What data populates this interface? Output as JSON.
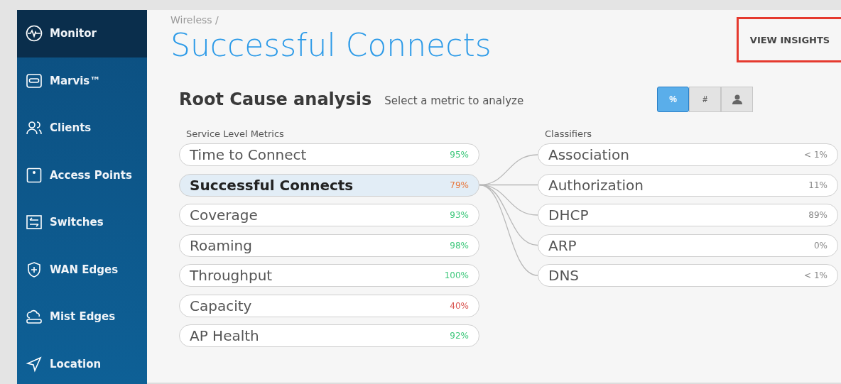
{
  "sidebar": {
    "items": [
      {
        "label": "Monitor",
        "kind": "monitor",
        "selected": true
      },
      {
        "label": "Marvis™",
        "kind": "marvis",
        "selected": false
      },
      {
        "label": "Clients",
        "kind": "clients",
        "selected": false
      },
      {
        "label": "Access Points",
        "kind": "ap",
        "selected": false
      },
      {
        "label": "Switches",
        "kind": "switches",
        "selected": false
      },
      {
        "label": "WAN Edges",
        "kind": "wan",
        "selected": false
      },
      {
        "label": "Mist Edges",
        "kind": "mist",
        "selected": false
      },
      {
        "label": "Location",
        "kind": "location",
        "selected": false
      }
    ]
  },
  "breadcrumb": "Wireless /",
  "title": "Successful Connects",
  "view_insights": "VIEW INSIGHTS",
  "analysis": {
    "heading": "Root Cause analysis",
    "hint": "Select a metric to analyze",
    "units": [
      {
        "kind": "text",
        "label": "%",
        "selected": true
      },
      {
        "kind": "text",
        "label": "#",
        "selected": false
      },
      {
        "kind": "person",
        "selected": false
      }
    ],
    "metrics_heading": "Service Level Metrics",
    "metrics": [
      {
        "name": "Time to Connect",
        "value": "95%",
        "color": "#3cc77a",
        "selected": false
      },
      {
        "name": "Successful Connects",
        "value": "79%",
        "color": "#e8773c",
        "selected": true
      },
      {
        "name": "Coverage",
        "value": "93%",
        "color": "#3cc77a",
        "selected": false
      },
      {
        "name": "Roaming",
        "value": "98%",
        "color": "#3cc77a",
        "selected": false
      },
      {
        "name": "Throughput",
        "value": "100%",
        "color": "#3cc77a",
        "selected": false
      },
      {
        "name": "Capacity",
        "value": "40%",
        "color": "#d9534f",
        "selected": false
      },
      {
        "name": "AP Health",
        "value": "92%",
        "color": "#3cc77a",
        "selected": false
      }
    ],
    "classifiers_heading": "Classifiers",
    "classifiers": [
      {
        "name": "Association",
        "value": "< 1%"
      },
      {
        "name": "Authorization",
        "value": "11%"
      },
      {
        "name": "DHCP",
        "value": "89%"
      },
      {
        "name": "ARP",
        "value": "0%"
      },
      {
        "name": "DNS",
        "value": "< 1%"
      }
    ]
  }
}
